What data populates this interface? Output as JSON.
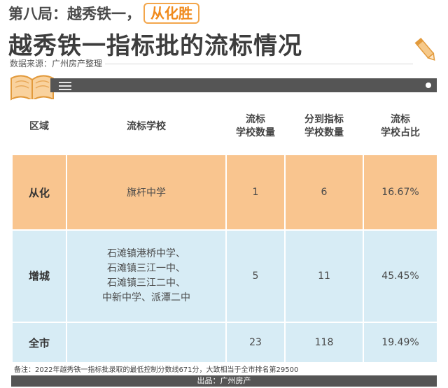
{
  "header": {
    "round_label": "第八局：越秀铁一，",
    "winner": "从化胜",
    "title": "越秀铁一指标批的流标情况",
    "source": "数据来源：广州房产整理"
  },
  "table": {
    "headers": [
      "区域",
      "流标学校",
      "流标\n学校数量",
      "分到指标\n学校数量",
      "流标\n学校占比"
    ],
    "rows": [
      {
        "region": "从化",
        "schools": "旗杆中学",
        "failed_count": "1",
        "assigned_count": "6",
        "ratio": "16.67%"
      },
      {
        "region": "增城",
        "schools": "石滩镇港桥中学、\n石滩镇三江一中、\n石滩镇三江二中、\n中新中学、派潭二中",
        "failed_count": "5",
        "assigned_count": "11",
        "ratio": "45.45%"
      },
      {
        "region": "全市",
        "schools": "",
        "failed_count": "23",
        "assigned_count": "118",
        "ratio": "19.49%"
      }
    ]
  },
  "note": "备注：2022年越秀铁一指标批录取的最低控制分数线671分，大致相当于全市排名第29500",
  "footer": "出品：广州房产",
  "colors": {
    "accent": "#f3a64b",
    "row_orange": "#f9c58f",
    "row_blue": "#d7ecf5",
    "bar": "#555555"
  },
  "icons": [
    "pencil-icon",
    "book-icon",
    "menu-icon"
  ]
}
